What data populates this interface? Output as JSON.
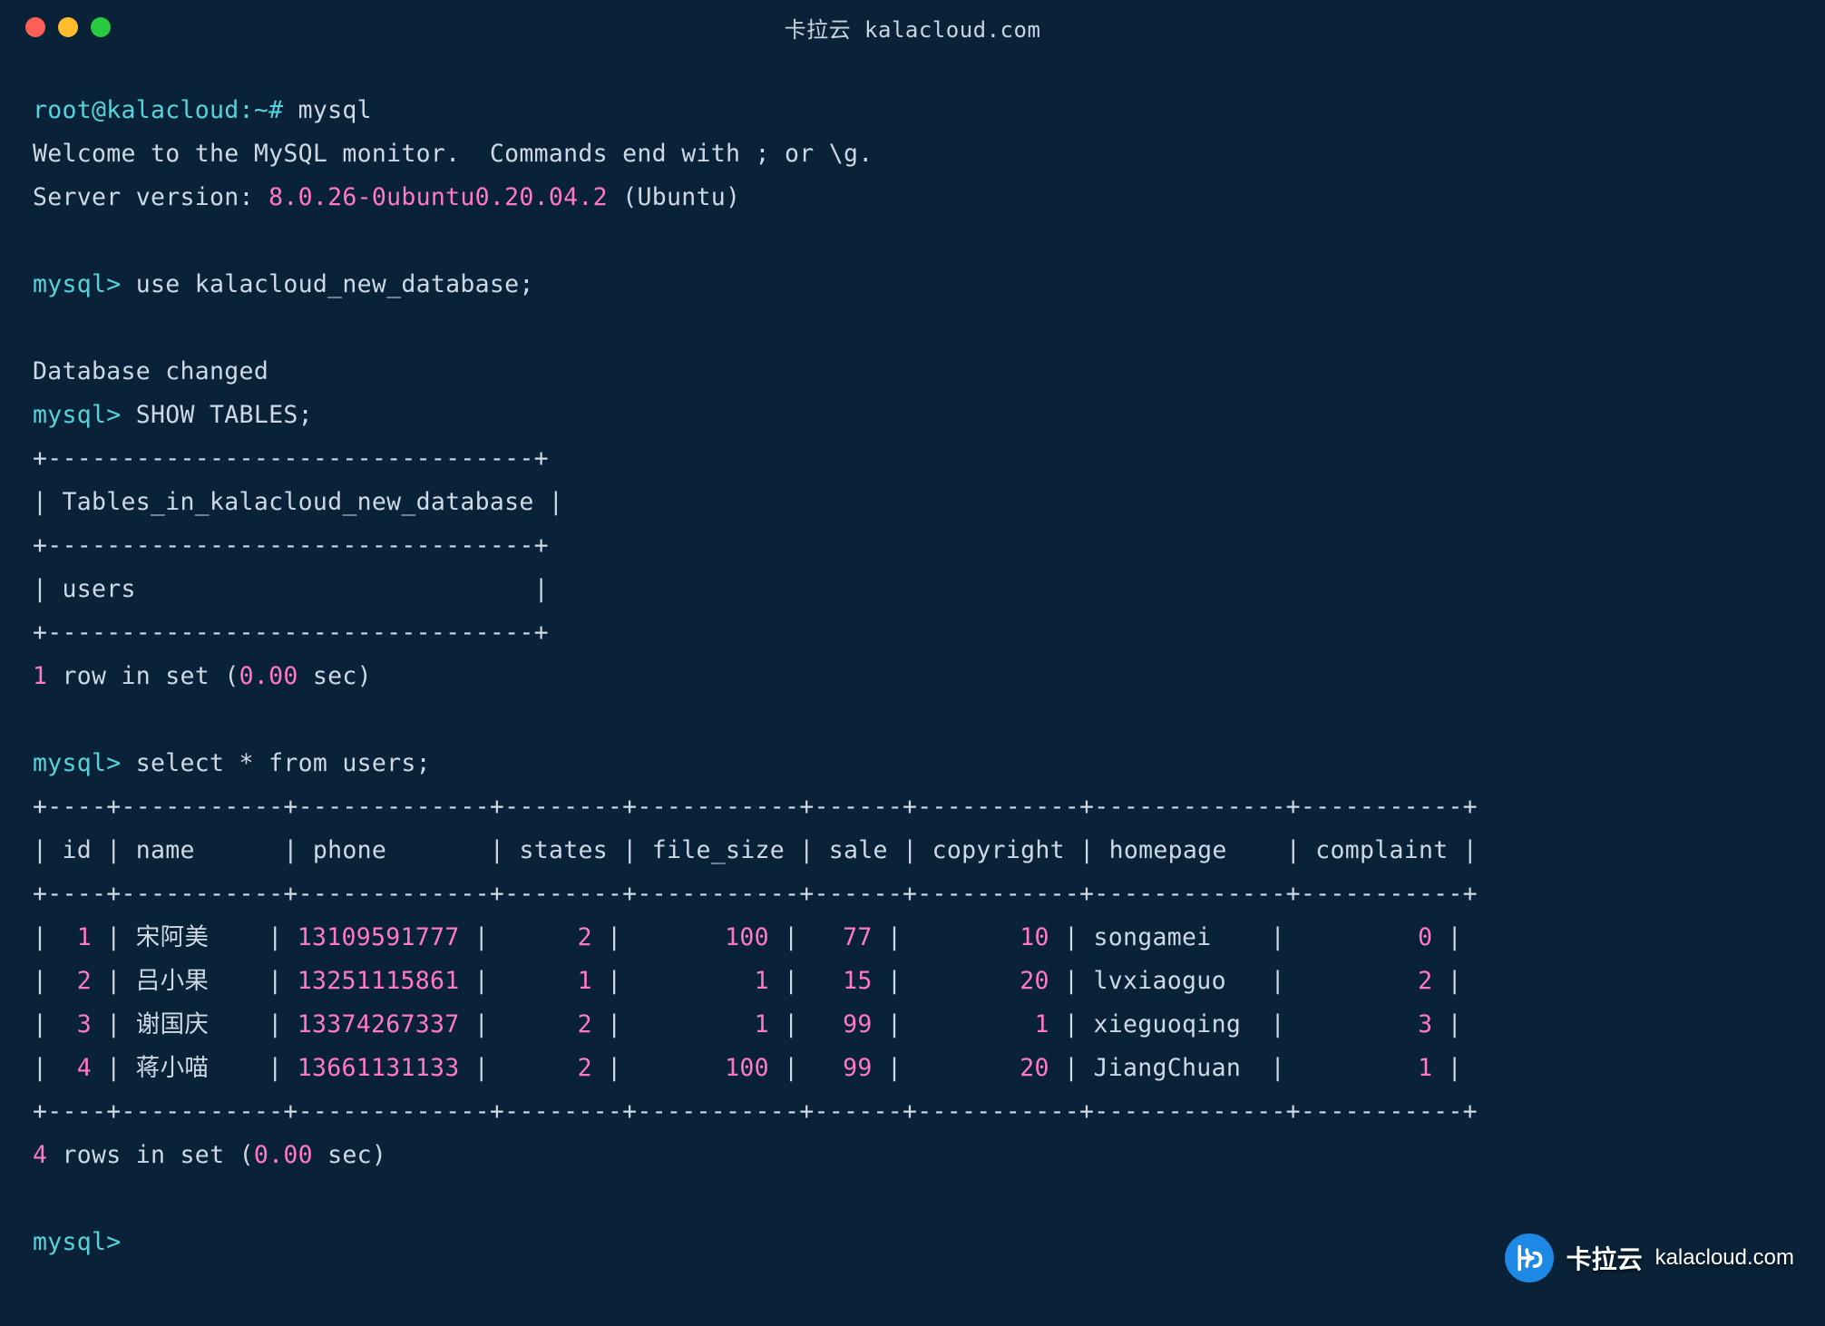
{
  "window": {
    "title": "卡拉云 kalacloud.com"
  },
  "prompt": {
    "root": "root@kalacloud:~# ",
    "mysql": "mysql> "
  },
  "cmd": {
    "mysql_launch": "mysql",
    "use_db": "use kalacloud_new_database;",
    "show_tables": "SHOW TABLES;",
    "select": "select * from users;"
  },
  "msg": {
    "welcome": "Welcome to the MySQL monitor.  Commands end with ; or \\g.",
    "server_label": "Server version: ",
    "server_version": "8.0.26-0ubuntu0.20.04.2",
    "server_suffix": " (Ubuntu)",
    "db_changed": "Database changed"
  },
  "tables_box": {
    "border": "+---------------------------------+",
    "header": "| Tables_in_kalacloud_new_database |",
    "row": "| users                           |",
    "footer_count": "1",
    "footer_prefix": " row in set (",
    "footer_time": "0.00",
    "footer_suffix": " sec)"
  },
  "users_table": {
    "border": "+----+-----------+-------------+--------+-----------+------+-----------+-------------+-----------+",
    "headers": [
      "id",
      "name",
      "phone",
      "states",
      "file_size",
      "sale",
      "copyright",
      "homepage",
      "complaint"
    ],
    "rows": [
      {
        "id": "1",
        "name": "宋阿美",
        "phone": "13109591777",
        "states": "2",
        "file_size": "100",
        "sale": "77",
        "copyright": "10",
        "homepage": "songamei",
        "complaint": "0"
      },
      {
        "id": "2",
        "name": "吕小果",
        "phone": "13251115861",
        "states": "1",
        "file_size": "1",
        "sale": "15",
        "copyright": "20",
        "homepage": "lvxiaoguo",
        "complaint": "2"
      },
      {
        "id": "3",
        "name": "谢国庆",
        "phone": "13374267337",
        "states": "2",
        "file_size": "1",
        "sale": "99",
        "copyright": "1",
        "homepage": "xieguoqing",
        "complaint": "3"
      },
      {
        "id": "4",
        "name": "蒋小喵",
        "phone": "13661131133",
        "states": "2",
        "file_size": "100",
        "sale": "99",
        "copyright": "20",
        "homepage": "JiangChuan",
        "complaint": "1"
      }
    ],
    "footer_count": "4",
    "footer_prefix": " rows in set (",
    "footer_time": "0.00",
    "footer_suffix": " sec)"
  },
  "watermark": {
    "brand": "卡拉云",
    "domain": "kalacloud.com"
  }
}
